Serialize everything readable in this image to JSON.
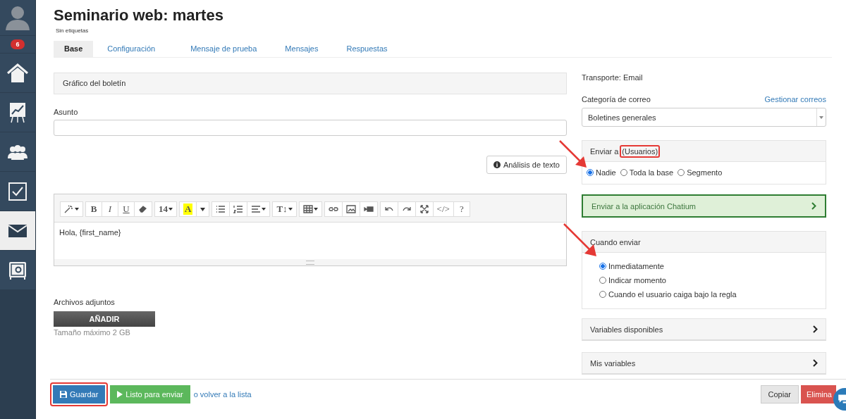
{
  "sidebar": {
    "badge": "6",
    "items": [
      {
        "selected": false
      },
      {
        "selected": false
      },
      {
        "selected": false
      },
      {
        "selected": false
      },
      {
        "selected": true
      },
      {
        "selected": false
      }
    ]
  },
  "title": "Seminario web: martes",
  "tags": "Sin etiquetas",
  "tabs": [
    {
      "label": "Base",
      "selected": true
    },
    {
      "label": "Configuración",
      "selected": false
    },
    {
      "label": "Mensaje de prueba",
      "selected": false
    },
    {
      "label": "Mensajes",
      "selected": false
    },
    {
      "label": "Respuestas",
      "selected": false
    }
  ],
  "graphic_panel": "Gráfico del boletín",
  "subject": {
    "label": "Asunto"
  },
  "text_analysis_button": "Análisis de texto",
  "editor": {
    "toolbar": [
      [
        {
          "kind": "icon",
          "caret": true
        }
      ],
      [
        {
          "kind": "text",
          "label": "B"
        },
        {
          "kind": "text",
          "label": "I"
        },
        {
          "kind": "text",
          "label": "U"
        },
        {
          "kind": "icon"
        }
      ],
      [
        {
          "kind": "text",
          "label": "14",
          "caret": true
        }
      ],
      [
        {
          "kind": "highlight",
          "label": "A"
        },
        {
          "kind": "caret"
        }
      ],
      [
        {
          "kind": "icon"
        },
        {
          "kind": "icon"
        },
        {
          "kind": "icon",
          "caret": true
        }
      ],
      [
        {
          "kind": "text",
          "label": "T↕",
          "caret": true
        }
      ],
      [
        {
          "kind": "icon",
          "caret": true
        }
      ],
      [
        {
          "kind": "icon"
        },
        {
          "kind": "icon"
        },
        {
          "kind": "icon"
        }
      ],
      [
        {
          "kind": "icon"
        },
        {
          "kind": "icon"
        },
        {
          "kind": "icon"
        },
        {
          "kind": "text",
          "label": "</>"
        },
        {
          "kind": "text",
          "label": "?"
        }
      ]
    ],
    "content": "Hola, {first_name}"
  },
  "attachments": {
    "label": "Archivos adjuntos",
    "button": "AÑADIR",
    "hint": "Tamaño máximo 2 GB"
  },
  "transport": "Transporte: Email",
  "mail_category": {
    "label": "Categoría de correo",
    "link": "Gestionar correos",
    "value": "Boletines generales"
  },
  "send_to": {
    "title": "Enviar a",
    "audience": "(Usuarios)",
    "highlighted": true,
    "arrow": true,
    "options": [
      {
        "label": "Nadie",
        "selected": true
      },
      {
        "label": "Toda la base",
        "selected": false
      },
      {
        "label": "Segmento",
        "selected": false
      }
    ]
  },
  "chatium_panel": "Enviar a la aplicación Chatium",
  "when": {
    "title": "Cuando enviar",
    "arrow": true,
    "options": [
      {
        "label": "Inmediatamente",
        "selected": true
      },
      {
        "label": "Indicar momento",
        "selected": false
      },
      {
        "label": "Cuando el usuario caiga bajo la regla",
        "selected": false
      }
    ]
  },
  "collapsibles": [
    "Variables disponibles",
    "Mis variables"
  ],
  "footer": {
    "save": {
      "label": "Guardar",
      "highlighted": true
    },
    "ready": "Listo para enviar",
    "back": "o volver a la lista",
    "copy": "Copiar",
    "delete": "Elimina"
  }
}
